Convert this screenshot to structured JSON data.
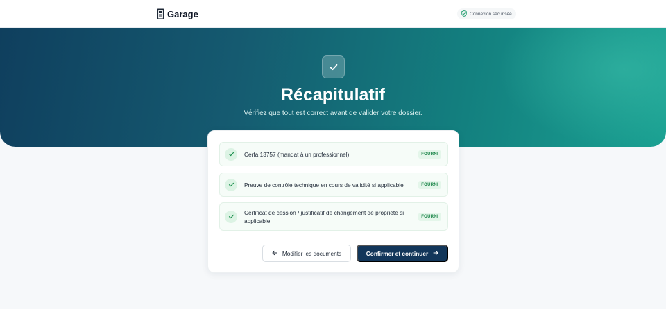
{
  "header": {
    "brand_name": "Garage",
    "brand_icon": "phone-booth-icon",
    "secure_badge": "Connexion sécurisée",
    "secure_icon": "shield-check-icon"
  },
  "hero": {
    "title": "Récapitulatif",
    "subtitle": "Vérifiez que tout est correct avant de valider votre dossier.",
    "icon": "check-icon",
    "colors": {
      "start": "#0f3f5e",
      "end": "#1aa192"
    }
  },
  "documents": [
    {
      "label": "Cerfa 13757 (mandat à un professionnel)",
      "status": "FOURNI"
    },
    {
      "label": "Preuve de contrôle technique en cours de validité si applicable",
      "status": "FOURNI"
    },
    {
      "label": "Certificat de cession / justificatif de changement de propriété si applicable",
      "status": "FOURNI"
    }
  ],
  "actions": {
    "back_label": "Modifier les documents",
    "back_icon": "arrow-left-icon",
    "confirm_label": "Confirmer et continuer",
    "confirm_icon": "arrow-right-icon"
  },
  "colors": {
    "primary": "#12365a",
    "success": "#198447",
    "success_bg": "#e4f6ea"
  }
}
